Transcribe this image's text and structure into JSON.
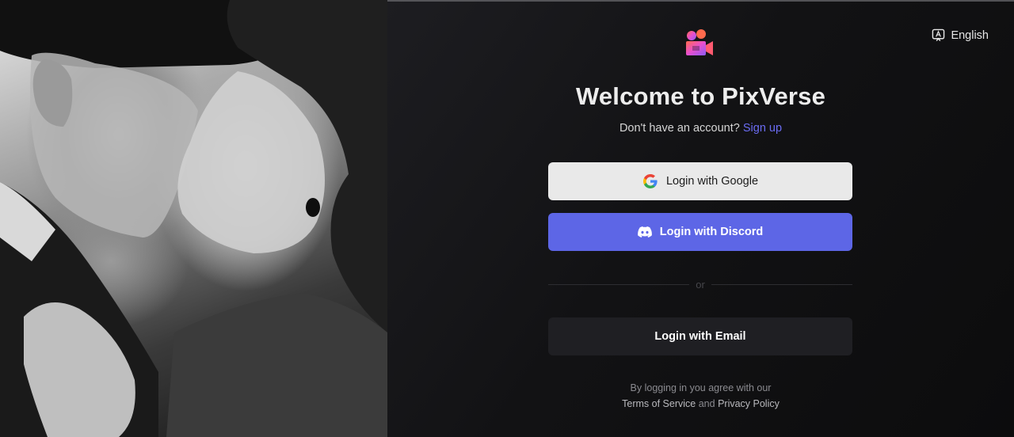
{
  "hero": {
    "image_alt": "Black and white photo of a couple about to kiss",
    "icon": "hero-photo"
  },
  "header": {
    "language_label": "English",
    "language_icon": "language-icon",
    "logo_icon": "pixverse-logo-icon"
  },
  "login": {
    "title": "Welcome to PixVerse",
    "no_account_text": "Don't have an account?",
    "signup_label": "Sign up",
    "google_label": "Login with Google",
    "discord_label": "Login with Discord",
    "divider_label": "or",
    "email_label": "Login with Email"
  },
  "footer": {
    "agree_text": "By logging in you agree with our",
    "terms_label": "Terms of Service",
    "and_text": "and",
    "privacy_label": "Privacy Policy"
  },
  "colors": {
    "accent": "#5d66e6",
    "link": "#6b6cf2",
    "background": "#121214",
    "google_button": "#e9e9e9",
    "email_button": "#1f1f23"
  }
}
